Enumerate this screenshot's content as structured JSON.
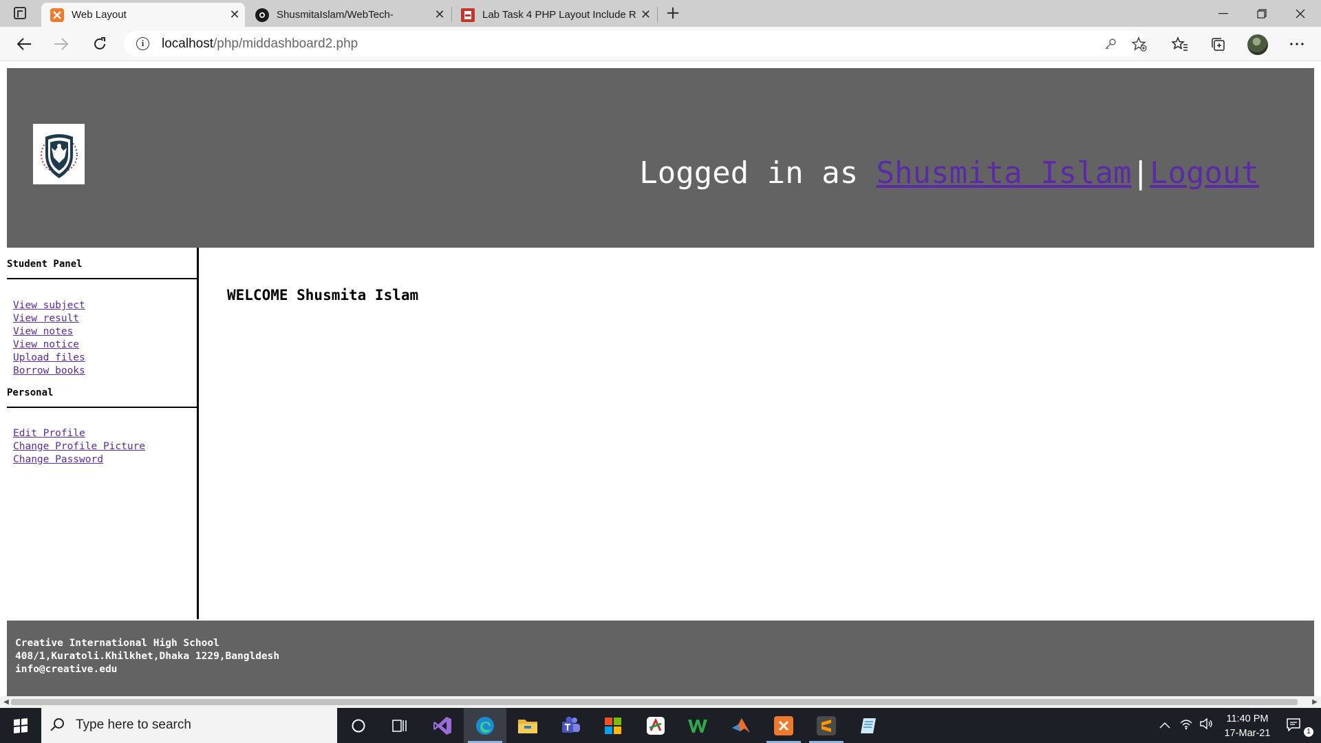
{
  "browser": {
    "tabs": [
      {
        "title": "Web Layout",
        "active": true,
        "icon": "xampp-icon"
      },
      {
        "title": "ShusmitaIslam/WebTech-",
        "active": false,
        "icon": "github-icon"
      },
      {
        "title": "Lab Task 4 PHP Layout Include Re",
        "active": false,
        "icon": "pdf-icon"
      }
    ],
    "close_glyph": "✕",
    "new_tab_glyph": "+",
    "url_host": "localhost",
    "url_path": "/php/middashboard2.php",
    "info_glyph": "i"
  },
  "header": {
    "logged_in_prefix": "Logged in as ",
    "user_name": "Shusmita Islam",
    "separator": "|",
    "logout_label": "Logout"
  },
  "sidebar": {
    "student_panel_heading": "Student Panel",
    "student_links": [
      "View subject",
      "View result",
      "View notes",
      "View notice",
      "Upload files",
      "Borrow books"
    ],
    "personal_heading": "Personal",
    "personal_links": [
      "Edit Profile",
      "Change Profile Picture",
      "Change Password"
    ]
  },
  "main": {
    "welcome": "WELCOME Shusmita Islam"
  },
  "footer": {
    "school_name": "Creative International High School",
    "address": "408/1,Kuratoli.Khilkhet,Dhaka 1229,Bangldesh",
    "email": "info@creative.edu"
  },
  "taskbar": {
    "search_placeholder": "Type here to search",
    "time": "11:40 PM",
    "date": "17-Mar-21",
    "notification_count": "1"
  },
  "colors": {
    "header_bg": "#636363",
    "link": "#5a2aa7",
    "taskbar_bg": "#1c1f26"
  }
}
